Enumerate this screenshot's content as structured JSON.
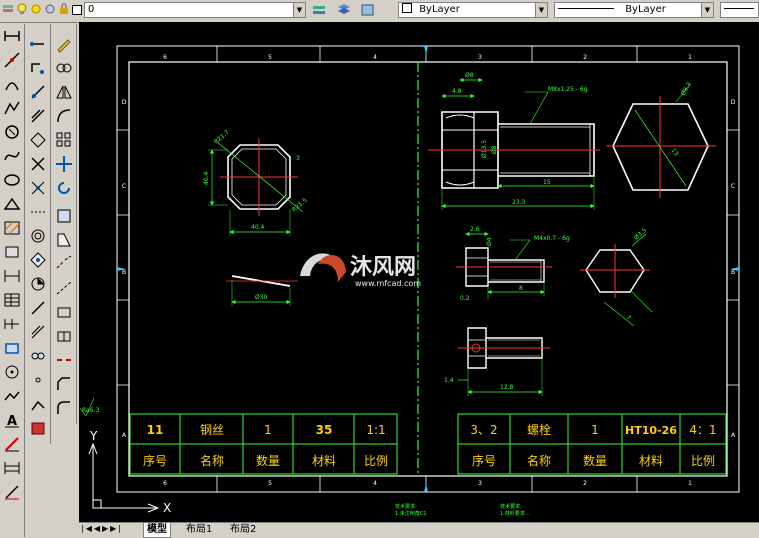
{
  "toolbar": {
    "layer_value": "0",
    "color_value": "ByLayer",
    "linetype_value": "ByLayer"
  },
  "title_left": {
    "row1": [
      "11",
      "钢丝",
      "1",
      "35",
      "1:1"
    ],
    "row2": [
      "序号",
      "名称",
      "数量",
      "材料",
      "比例"
    ]
  },
  "title_right": {
    "row1": [
      "3、2",
      "螺栓",
      "1",
      "HT10-26",
      "4：1"
    ],
    "row2": [
      "序号",
      "名称",
      "数量",
      "材料",
      "比例"
    ]
  },
  "dims": {
    "square_w": "40.4",
    "square_h": "40.4",
    "square_r1": "R21.7",
    "square_r2": "R21.5",
    "square_t": "3",
    "wire_d": "Ø39",
    "bolt1_h": "4.8",
    "bolt1_dk": "Ø8",
    "bolt1_thread": "M8x1.25 - 6g",
    "bolt1_d1": "Ø13.5",
    "bolt1_d2": "Ø8",
    "bolt1_len": "15",
    "bolt1_total": "23.3",
    "hex1_a": "Ø8.3",
    "hex1_b": "13",
    "bolt2_h": "2.6",
    "bolt2_d": "Ø4",
    "bolt2_thread": "M4x0.7 - 6g",
    "bolt2_len": "8",
    "bolt2_r": "0.2",
    "hex2_a": "Ø3.5",
    "hex2_b": "7",
    "bolt3_h": "1.4",
    "bolt3_len": "12.8",
    "ra": "Ra6.3"
  },
  "frame": {
    "top_nums": [
      "6",
      "5",
      "4",
      "3",
      "2",
      "1"
    ],
    "side_letters": [
      "D",
      "C",
      "B",
      "A"
    ]
  },
  "axis": {
    "y": "Y",
    "x": "X"
  },
  "watermark": {
    "brand": "沐风网",
    "url": "www.mfcad.com"
  },
  "notes": {
    "left_title": "技术要求:",
    "left_line": "1.未注倒角C1",
    "right_title": "技术要求:",
    "right_line": "1.材料要求..."
  },
  "tabs": [
    "模型",
    "布局1",
    "布局2"
  ]
}
